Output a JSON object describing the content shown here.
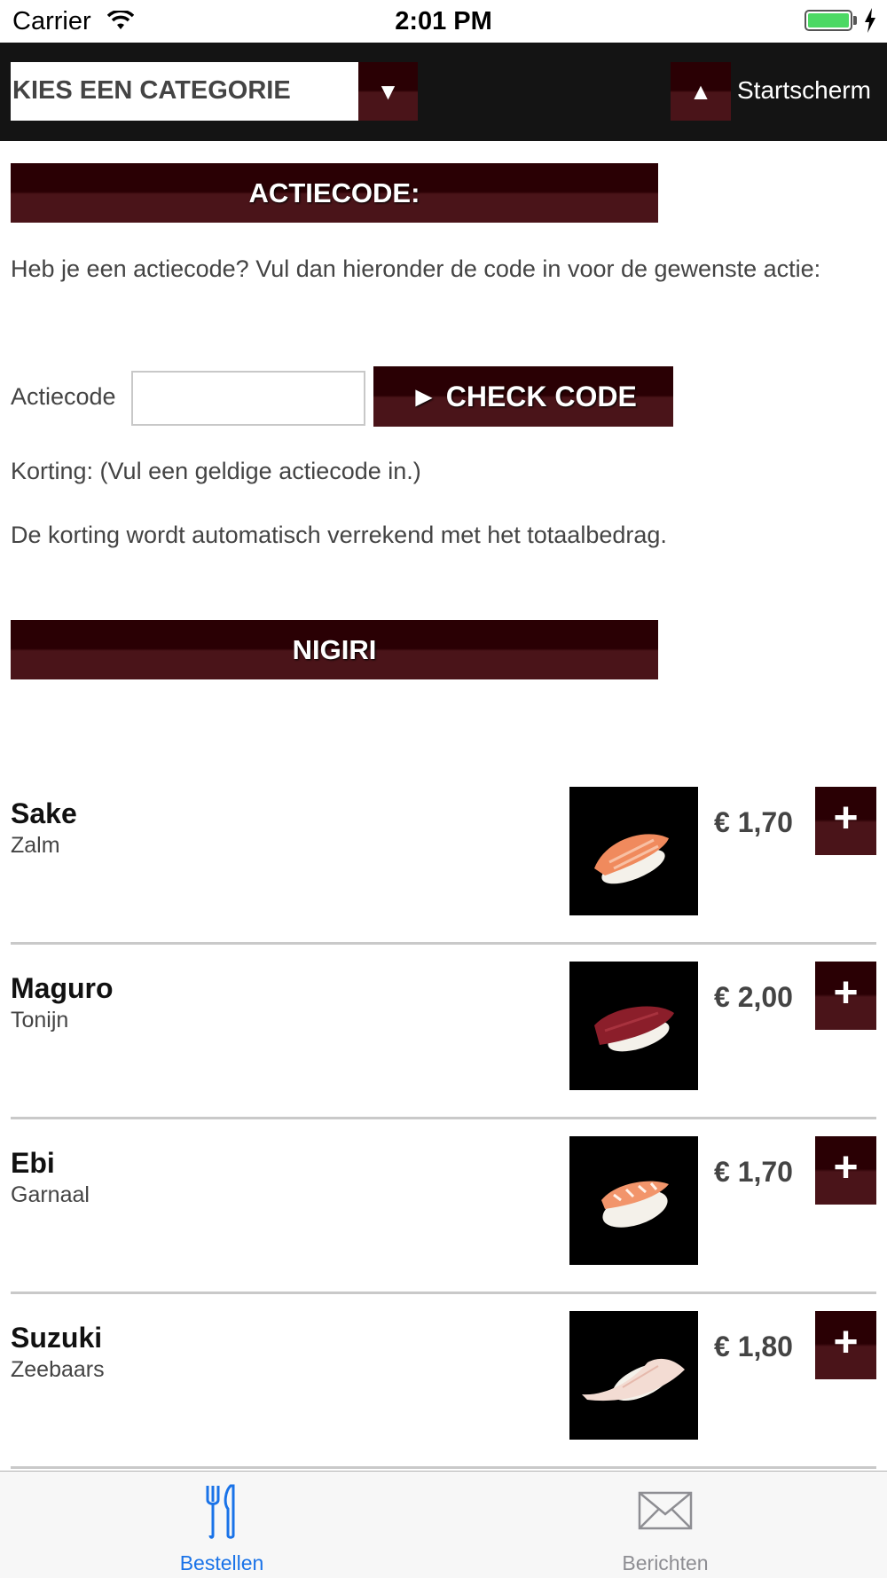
{
  "status_bar": {
    "carrier": "Carrier",
    "time": "2:01 PM"
  },
  "topnav": {
    "category_placeholder": "KIES EEN CATEGORIE",
    "home_label": "Startscherm"
  },
  "promo": {
    "header": "ACTIECODE:",
    "intro": "Heb je een actiecode? Vul dan hieronder de code in voor de gewenste actie:",
    "code_label": "Actiecode",
    "code_value": "",
    "check_button": "CHECK CODE",
    "korting": "Korting: (Vul een geldige actiecode in.)",
    "verrekend": "De korting wordt automatisch verrekend met het totaalbedrag."
  },
  "section": {
    "title": "NIGIRI"
  },
  "products": [
    {
      "name": "Sake",
      "subtitle": "Zalm",
      "price": "€ 1,70",
      "image": "salmon-nigiri",
      "color": "#f08a5d"
    },
    {
      "name": "Maguro",
      "subtitle": "Tonijn",
      "price": "€ 2,00",
      "image": "tuna-nigiri",
      "color": "#8b1e2a"
    },
    {
      "name": "Ebi",
      "subtitle": "Garnaal",
      "price": "€ 1,70",
      "image": "shrimp-nigiri",
      "color": "#f2956b"
    },
    {
      "name": "Suzuki",
      "subtitle": "Zeebaars",
      "price": "€ 1,80",
      "image": "seabass-nigiri",
      "color": "#f3dcd3"
    }
  ],
  "tabs": [
    {
      "label": "Bestellen",
      "icon": "fork-knife-icon",
      "active": true,
      "color": "#1a73e8"
    },
    {
      "label": "Berichten",
      "icon": "envelope-icon",
      "active": false,
      "color": "#8e8e93"
    }
  ]
}
